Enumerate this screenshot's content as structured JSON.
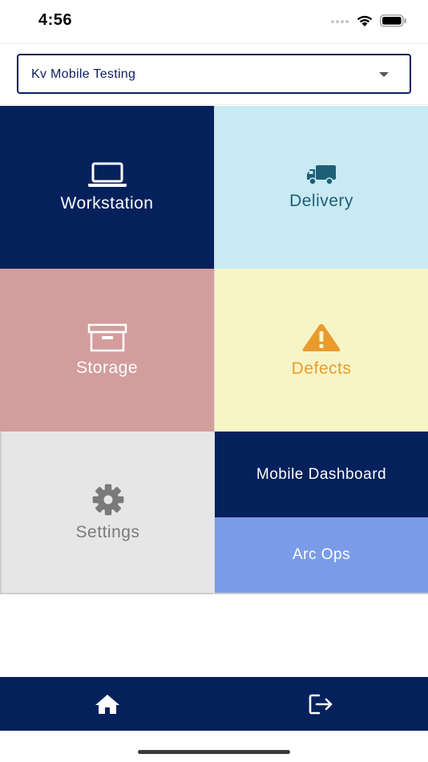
{
  "status_bar": {
    "time": "4:56"
  },
  "project_selector": {
    "value": "Kv Mobile Testing"
  },
  "tiles": {
    "workstation": {
      "label": "Workstation",
      "icon": "laptop-icon"
    },
    "delivery": {
      "label": "Delivery",
      "icon": "truck-icon"
    },
    "storage": {
      "label": "Storage",
      "icon": "archive-box-icon"
    },
    "defects": {
      "label": "Defects",
      "icon": "warning-icon"
    },
    "settings": {
      "label": "Settings",
      "icon": "gear-icon"
    },
    "mobile_dashboard": {
      "label": "Mobile Dashboard"
    },
    "arc_ops": {
      "label": "Arc Ops"
    }
  },
  "bottom_nav": {
    "items": [
      "home-icon",
      "logout-icon"
    ]
  },
  "colors": {
    "navy": "#05215c",
    "light_blue": "#c9eaf3",
    "rose": "#d39d9d",
    "pale_yellow": "#f7f5c6",
    "light_gray": "#e6e6e6",
    "periwinkle": "#7a9ce8",
    "orange": "#e99b2e",
    "teal": "#1d5f77"
  }
}
